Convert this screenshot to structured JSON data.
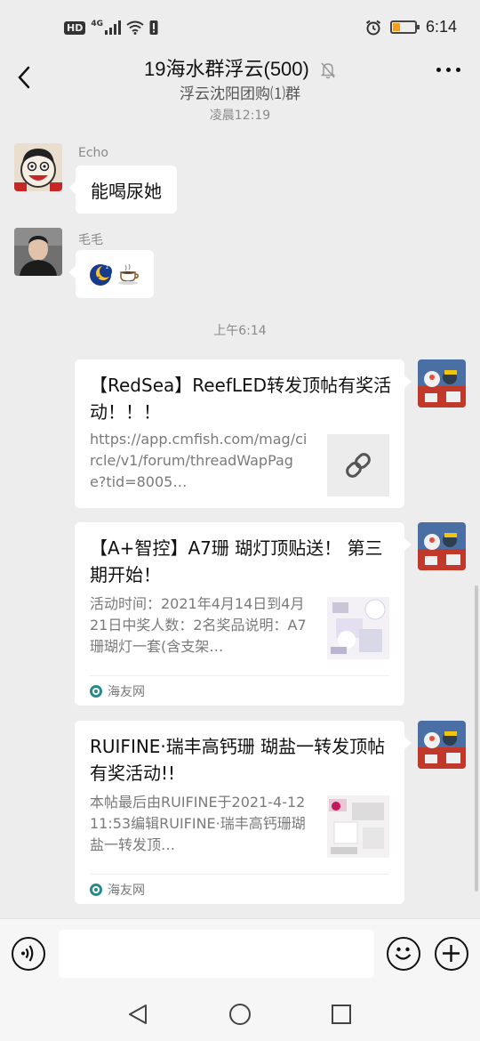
{
  "status_bar": {
    "network_badge": "HD",
    "network_type": "4G",
    "time": "6:14"
  },
  "header": {
    "title": "19海水群浮云(500)",
    "subtitle": "浮云沈阳团购⑴群"
  },
  "messages": [
    {
      "type": "timestamp",
      "text": "凌晨12:19"
    },
    {
      "type": "text",
      "sender": "Echo",
      "text": "能喝尿她"
    },
    {
      "type": "emoji",
      "sender": "毛毛",
      "icons": [
        "sleeping-moon-icon",
        "coffee-icon"
      ]
    },
    {
      "type": "timestamp",
      "text": "上午6:14"
    },
    {
      "type": "link_card",
      "title": "【RedSea】ReefLED转发顶帖有奖活动！！！",
      "description": "https://app.cmfish.com/mag/circle/v1/forum/threadWapPage?tid=8005…",
      "thumb_icon": "link-icon"
    },
    {
      "type": "link_card",
      "title": "【A+智控】A7珊 瑚灯顶贴送！ 第三期开始！",
      "description": "活动时间：2021年4月14日到4月21日中奖人数：2名奖品说明：A7珊瑚灯一套(含支架…",
      "source": "海友网"
    },
    {
      "type": "link_card",
      "title": "RUIFINE·瑞丰高钙珊 瑚盐一转发顶帖有奖活动!!",
      "description": "本帖最后由RUIFINE于2021-4-1211:53编辑RUIFINE·瑞丰高钙珊瑚盐一转发顶…",
      "source": "海友网"
    }
  ],
  "input_bar": {
    "voice_icon": "voice-icon",
    "emoji_icon": "emoji-icon",
    "plus_icon": "plus-icon"
  },
  "nav_bar": {
    "icons": [
      "back-triangle-icon",
      "home-circle-icon",
      "recents-square-icon"
    ]
  },
  "colors": {
    "background": "#ededed",
    "bubble": "#ffffff",
    "battery": "#f0a020"
  }
}
